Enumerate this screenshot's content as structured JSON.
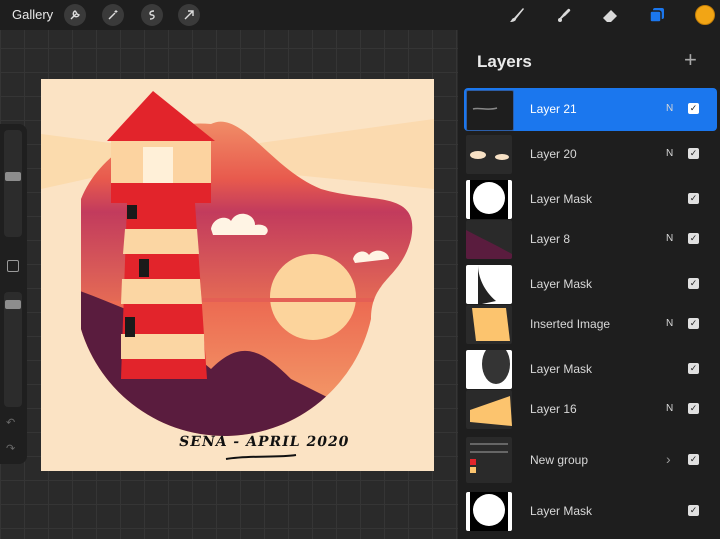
{
  "topbar": {
    "gallery_label": "Gallery",
    "left_tools": [
      "wrench-icon",
      "magic-wand-icon",
      "selection-icon",
      "transform-arrow-icon"
    ],
    "right_tools": [
      "brush-icon",
      "smudge-icon",
      "eraser-icon",
      "layers-icon"
    ],
    "active_color": "#f2a515"
  },
  "canvas": {
    "signature": "SENA - APRIL 2020"
  },
  "layers": {
    "title": "Layers",
    "add_symbol": "+",
    "items": [
      {
        "name": "Layer 21",
        "blend": "N",
        "selected": true
      },
      {
        "name": "Layer 20",
        "blend": "N"
      },
      {
        "name": "Layer Mask",
        "blend": ""
      },
      {
        "name": "Layer 8",
        "blend": "N"
      },
      {
        "name": "Layer Mask",
        "blend": ""
      },
      {
        "name": "Inserted Image",
        "blend": "N"
      },
      {
        "name": "Layer Mask",
        "blend": ""
      },
      {
        "name": "Layer 16",
        "blend": "N"
      },
      {
        "name": "New group",
        "blend": ""
      },
      {
        "name": "Layer Mask",
        "blend": ""
      }
    ]
  },
  "colors": {
    "accent": "#1b77ee",
    "panel": "#1e1e1e"
  }
}
